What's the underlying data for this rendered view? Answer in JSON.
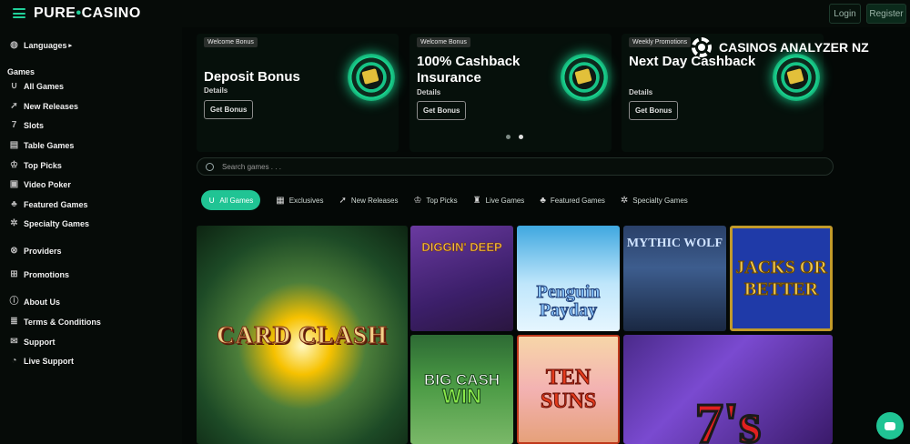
{
  "header": {
    "logo_left": "PURE",
    "logo_right": "CASINO",
    "login_label": "Login",
    "register_label": "Register"
  },
  "sidebar": {
    "languages": "Languages",
    "games_heading": "Games",
    "games": [
      {
        "label": "All Games",
        "icon": "horseshoe-icon"
      },
      {
        "label": "New Releases",
        "icon": "rocket-icon"
      },
      {
        "label": "Slots",
        "icon": "seven-icon"
      },
      {
        "label": "Table Games",
        "icon": "cards-icon"
      },
      {
        "label": "Top Picks",
        "icon": "trophy-icon"
      },
      {
        "label": "Video Poker",
        "icon": "monitor-icon"
      },
      {
        "label": "Featured Games",
        "icon": "clover-icon"
      },
      {
        "label": "Specialty Games",
        "icon": "gear-icon"
      }
    ],
    "providers": "Providers",
    "promotions": "Promotions",
    "about": "About Us",
    "terms": "Terms & Conditions",
    "support": "Support",
    "live_support": "Live Support"
  },
  "promos": [
    {
      "tag": "Welcome Bonus",
      "title": "Deposit Bonus",
      "details": "Details",
      "button": "Get Bonus"
    },
    {
      "tag": "Welcome Bonus",
      "title": "100% Cashback Insurance",
      "details": "Details",
      "button": "Get Bonus"
    },
    {
      "tag": "Weekly Promotions",
      "title": "Next Day Cashback",
      "details": "Details",
      "button": "Get Bonus"
    }
  ],
  "watermark": "CASINOS ANALYZER NZ",
  "search": {
    "placeholder": "Search games . . ."
  },
  "filters": [
    {
      "label": "All Games",
      "active": true
    },
    {
      "label": "Exclusives",
      "active": false
    },
    {
      "label": "New Releases",
      "active": false
    },
    {
      "label": "Top Picks",
      "active": false
    },
    {
      "label": "Live Games",
      "active": false
    },
    {
      "label": "Featured Games",
      "active": false
    },
    {
      "label": "Specialty Games",
      "active": false
    }
  ],
  "games": {
    "card_clash": "CARD CLASH",
    "diggin": "DIGGIN' DEEP",
    "penguin": "Penguin Payday",
    "wolf": "MYTHIC WOLF",
    "jacks": "JACKS OR BETTER",
    "bigcash_a": "BIG CASH",
    "bigcash_b": "WIN",
    "tensuns": "TEN SUNS",
    "sevens": "7's"
  },
  "colors": {
    "accent": "#20c494",
    "background": "#050a07"
  }
}
